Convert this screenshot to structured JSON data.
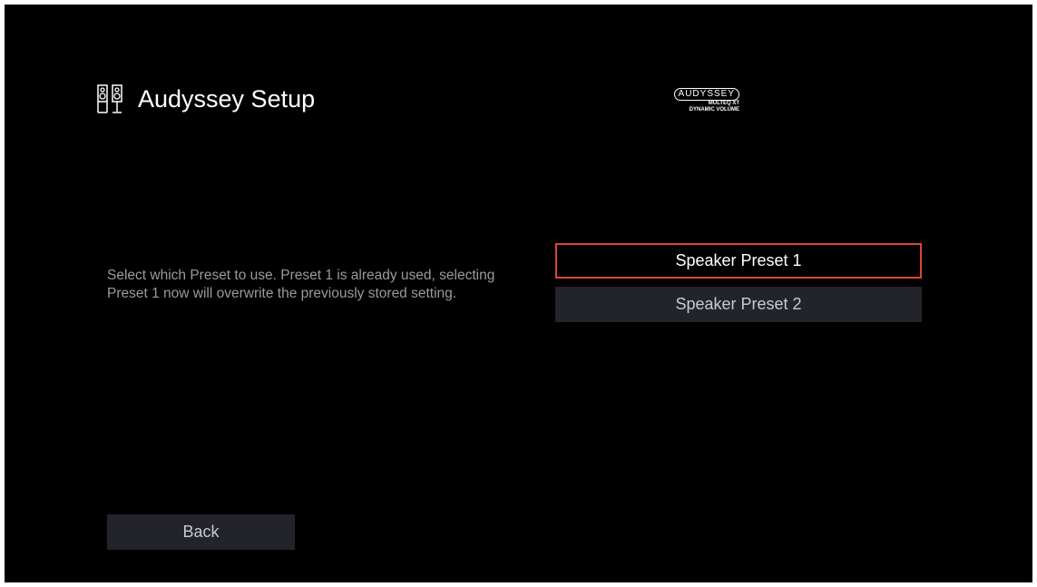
{
  "header": {
    "title": "Audyssey Setup",
    "icon": "speaker-icon"
  },
  "logo": {
    "brand": "AUDYSSEY",
    "line1": "MULTEQ XT",
    "line2": "DYNAMIC VOLUME"
  },
  "description": "Select which Preset to use. Preset 1 is already used, selecting Preset 1 now will overwrite the previously stored setting.",
  "presets": [
    {
      "label": "Speaker Preset 1",
      "selected": true
    },
    {
      "label": "Speaker Preset 2",
      "selected": false
    }
  ],
  "back_label": "Back",
  "colors": {
    "background": "#000000",
    "focus_border": "#e0442e",
    "button_bg": "#23232c",
    "description_text": "#9a9aa0"
  }
}
